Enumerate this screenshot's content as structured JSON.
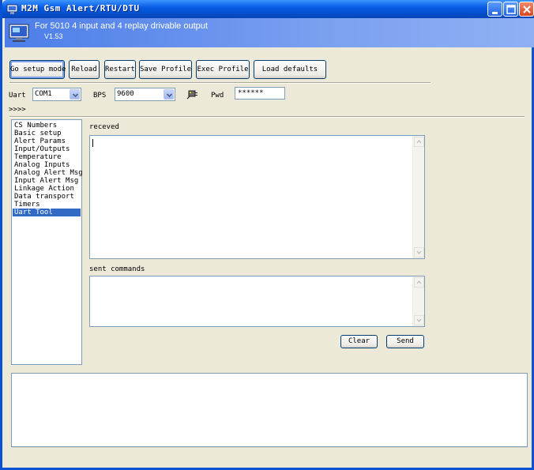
{
  "window": {
    "title": "M2M Gsm Alert/RTU/DTU"
  },
  "banner": {
    "title": "For 5010 4 input and 4 replay drivable output",
    "version": "V1.53"
  },
  "toolbar": {
    "go_setup_mode": "Go setup mode",
    "reload": "Reload",
    "restart": "Restart",
    "save_profile": "Save Profile",
    "exec_profile": "Exec Profile",
    "load_defaults": "Load defaults"
  },
  "connection": {
    "uart_label": "Uart",
    "uart_value": "COM1",
    "bps_label": "BPS",
    "bps_value": "9600",
    "pwd_label": "Pwd",
    "pwd_value": "******"
  },
  "indicator": ">>>>",
  "sidebar": {
    "items": [
      {
        "label": "CS Numbers"
      },
      {
        "label": "Basic setup"
      },
      {
        "label": "Alert Params"
      },
      {
        "label": "Input/Outputs"
      },
      {
        "label": "Temperature"
      },
      {
        "label": "Analog Inputs"
      },
      {
        "label": "Analog Alert Msg"
      },
      {
        "label": "Input Alert Msg"
      },
      {
        "label": "Linkage Action"
      },
      {
        "label": "Data transport"
      },
      {
        "label": "Timers"
      },
      {
        "label": "Uart Tool"
      }
    ],
    "selected": "Uart Tool"
  },
  "uart_tool": {
    "received_label": "receved",
    "received_text": "",
    "sent_label": "sent commands",
    "sent_text": "",
    "clear_label": "Clear",
    "send_label": "Send"
  },
  "log": {
    "text": ""
  },
  "colors": {
    "titlebar": "#0a5de6",
    "banner": "#7aa0f0",
    "selection": "#316ac5",
    "face": "#ece9d8"
  },
  "icons": {
    "app": "app-monitor-icon",
    "connect": "connector-plug-icon"
  }
}
